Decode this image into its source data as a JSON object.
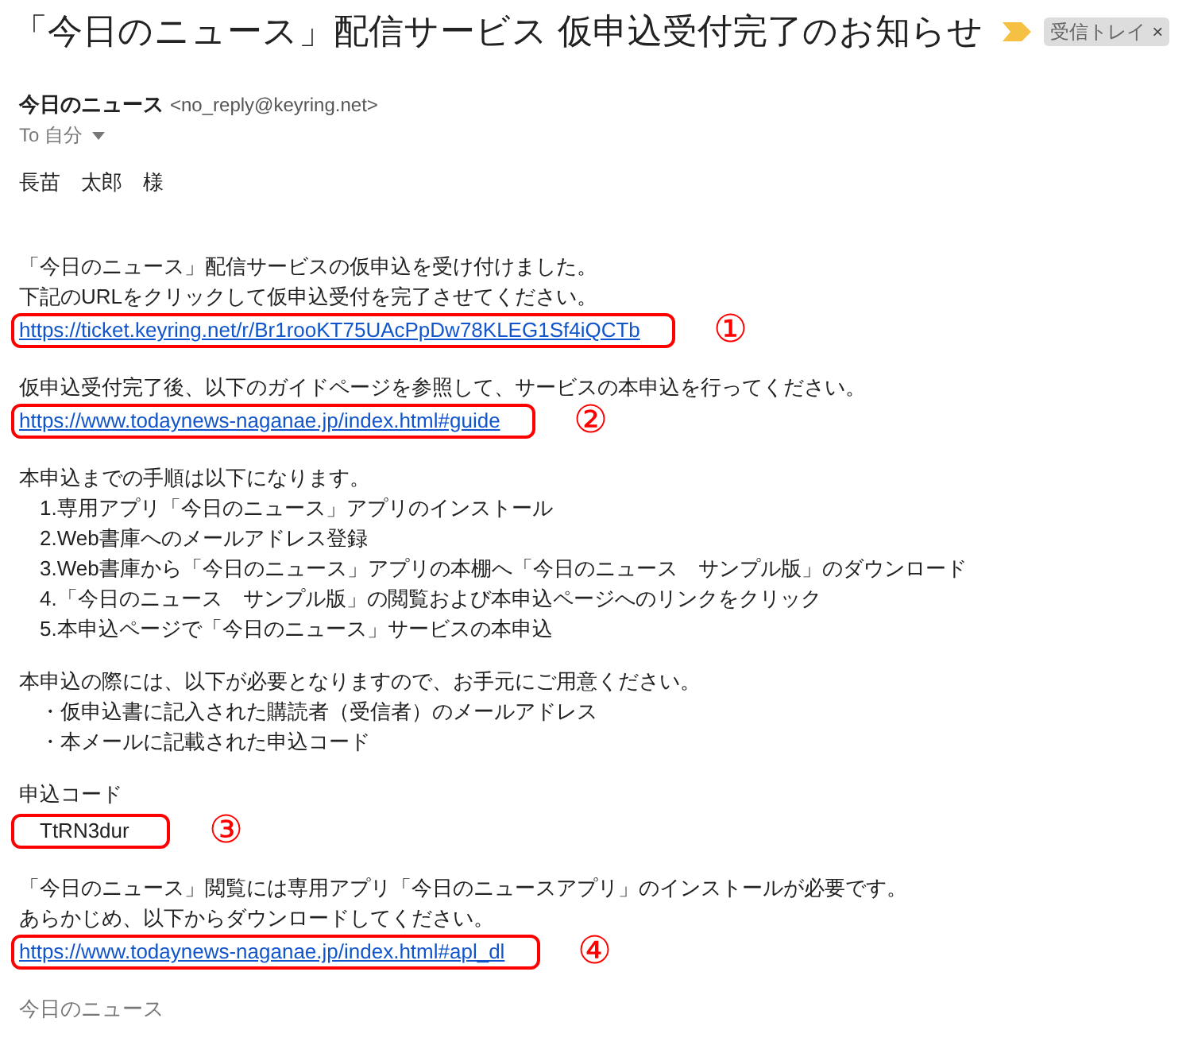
{
  "subject": "「今日のニュース」配信サービス 仮申込受付完了のお知らせ",
  "label": {
    "text": "受信トレイ",
    "close": "×"
  },
  "sender": {
    "name": "今日のニュース",
    "email": "<no_reply@keyring.net>"
  },
  "recipient": "To 自分",
  "greeting": "長苗　太郎　様",
  "sections": [
    [
      {
        "kind": "paragraph",
        "lines": [
          "「今日のニュース」配信サービスの仮申込を受け付けました。",
          "下記のURLをクリックして仮申込受付を完了させてください。"
        ]
      },
      {
        "kind": "link",
        "text": "https://ticket.keyring.net/r/Br1rooKT75UAcPpDw78KLEG1Sf4iQCTb",
        "marker": "①"
      }
    ],
    [
      {
        "kind": "paragraph",
        "lines": [
          "仮申込受付完了後、以下のガイドページを参照して、サービスの本申込を行ってください。"
        ]
      },
      {
        "kind": "link",
        "text": "https://www.todaynews-naganae.jp/index.html#guide",
        "marker": "②"
      }
    ],
    [
      {
        "kind": "paragraph",
        "lines": [
          "本申込までの手順は以下になります。"
        ]
      },
      {
        "kind": "list",
        "items": [
          "1.専用アプリ「今日のニュース」アプリのインストール",
          "2.Web書庫へのメールアドレス登録",
          "3.Web書庫から「今日のニュース」アプリの本棚へ「今日のニュース　サンプル版」のダウンロード",
          "4.「今日のニュース　サンプル版」の閲覧および本申込ページへのリンクをクリック",
          "5.本申込ページで「今日のニュース」サービスの本申込"
        ]
      }
    ],
    [
      {
        "kind": "paragraph",
        "lines": [
          "本申込の際には、以下が必要となりますので、お手元にご用意ください。"
        ]
      },
      {
        "kind": "bullets",
        "items": [
          "・仮申込書に記入された購読者（受信者）のメールアドレス",
          "・本メールに記載された申込コード"
        ]
      }
    ],
    [
      {
        "kind": "paragraph",
        "lines": [
          "申込コード"
        ]
      },
      {
        "kind": "code",
        "text": "TtRN3dur",
        "marker": "③"
      }
    ],
    [
      {
        "kind": "paragraph",
        "lines": [
          "「今日のニュース」閲覧には専用アプリ「今日のニュースアプリ」のインストールが必要です。",
          "あらかじめ、以下からダウンロードしてください。"
        ]
      },
      {
        "kind": "link",
        "text": "https://www.todaynews-naganae.jp/index.html#apl_dl",
        "marker": "④"
      }
    ]
  ],
  "signature": "今日のニュース"
}
